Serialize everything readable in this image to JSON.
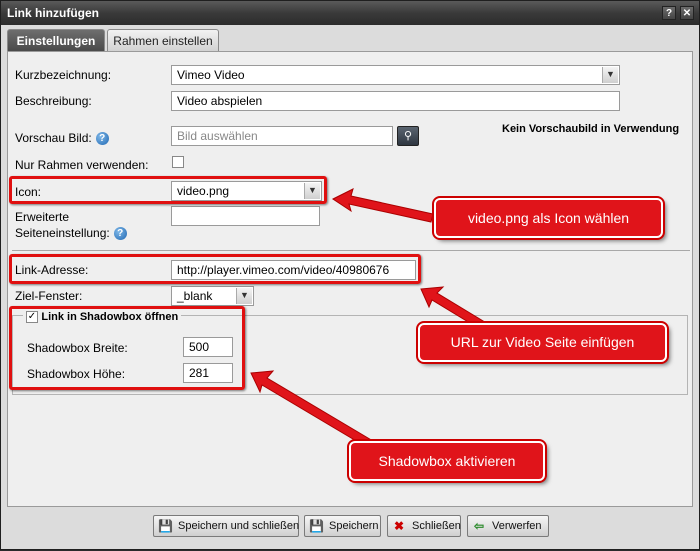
{
  "window": {
    "title": "Link hinzufügen",
    "btn_help": "?",
    "btn_close": "✕"
  },
  "tabs": [
    {
      "label": "Einstellungen"
    },
    {
      "label": "Rahmen einstellen"
    }
  ],
  "form": {
    "kurzbezeichnung": {
      "label": "Kurzbezeichnung:",
      "value": "Vimeo Video"
    },
    "beschreibung": {
      "label": "Beschreibung:",
      "value": "Video abspielen"
    },
    "vorschau": {
      "label": "Vorschau Bild:",
      "placeholder": "Bild auswählen",
      "status": "Kein Vorschaubild in Verwendung"
    },
    "nur_rahmen": {
      "label": "Nur Rahmen verwenden:"
    },
    "icon": {
      "label": "Icon:",
      "value": "video.png"
    },
    "erweiterte": {
      "label_line1": "Erweiterte",
      "label_line2": "Seiteneinstellung:",
      "value": ""
    },
    "link_adresse": {
      "label": "Link-Adresse:",
      "value": "http://player.vimeo.com/video/40980676"
    },
    "ziel_fenster": {
      "label": "Ziel-Fenster:",
      "value": "_blank"
    },
    "shadowbox": {
      "legend": "Link in Shadowbox öffnen",
      "checked": true,
      "breite": {
        "label": "Shadowbox Breite:",
        "value": "500"
      },
      "hoehe": {
        "label": "Shadowbox Höhe:",
        "value": "281"
      }
    }
  },
  "annotations": {
    "icon": "video.png als Icon wählen",
    "url": "URL zur Video Seite einfügen",
    "shadowbox": "Shadowbox aktivieren",
    "color": "#e0141a"
  },
  "footer": {
    "save_close": "Speichern und schließen",
    "save": "Speichern",
    "close": "Schließen",
    "discard": "Verwerfen"
  }
}
